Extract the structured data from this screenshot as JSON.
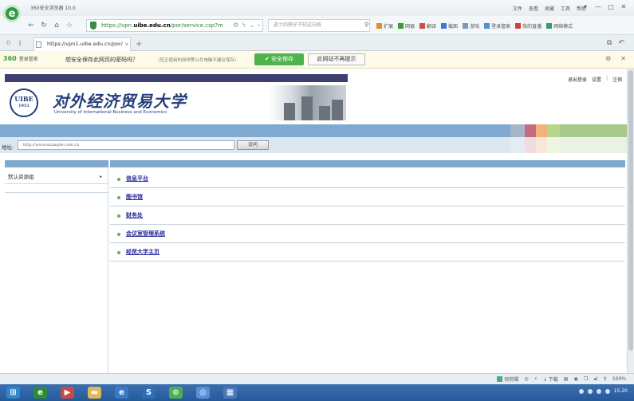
{
  "browser": {
    "title": "360安全浏览器 10.0",
    "menu": [
      "文件",
      "查看",
      "收藏",
      "工具",
      "帮助"
    ],
    "url_prefix": "https://vpn.",
    "url_host": "uibe.edu.cn",
    "url_path": "/por/service.csp?m",
    "search_placeholder": "道士的熊仔不知这向统",
    "extensions": [
      "扩展",
      "网银",
      "翻译",
      "截图",
      "游戏",
      "登录管家",
      "我的直播",
      "网络模式"
    ],
    "tab_title": "https://vpn1.uibe.edu.cn/por/"
  },
  "password_bar": {
    "brand": "360",
    "brand_sub": "登录管家",
    "question": "想安全保存此网页的密码吗？",
    "hint": "（您正使用的网吧等公共电脑不建议保存）",
    "save_label": "安全保存",
    "never_label": "此网站不再提示"
  },
  "site": {
    "emblem_text": "UIBE",
    "emblem_year": "1951",
    "name_cn": "对外经济贸易大学",
    "name_en": "University of International Business and Economics",
    "user_links": [
      "退出登录",
      "设置",
      "注销"
    ],
    "addr_label": "地址:",
    "addr_placeholder": "http://www.example.com.cn",
    "addr_go": "访问"
  },
  "left_menu": {
    "items": [
      {
        "label": "默认资源组"
      }
    ]
  },
  "resources": [
    {
      "label": "信息平台"
    },
    {
      "label": "图书馆"
    },
    {
      "label": "财务处"
    },
    {
      "label": "会议室管理系统"
    },
    {
      "label": "经贸大学主页"
    }
  ],
  "status": {
    "items": [
      "快剪辑",
      "下载",
      "100%"
    ]
  },
  "taskbar": {
    "time": "15:20"
  },
  "colors": {
    "accent_blue": "#7fa9d1",
    "save_green": "#4db34d",
    "brand_navy": "#243e7a"
  }
}
